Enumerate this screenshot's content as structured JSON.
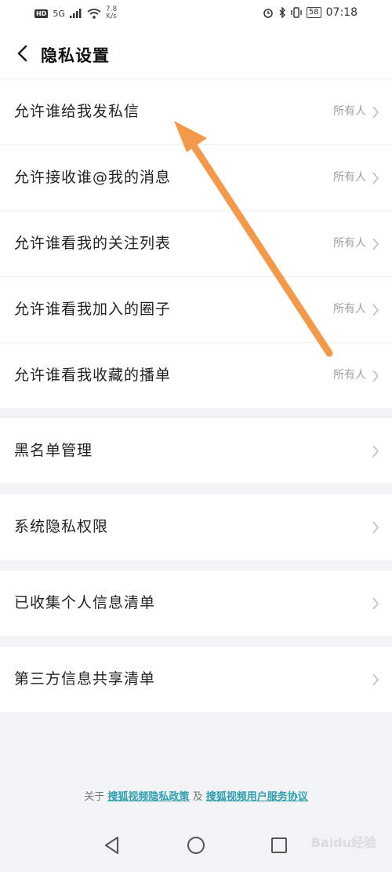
{
  "status_bar": {
    "hd": "HD",
    "signal": "5G",
    "net_speed_value": "7.8",
    "net_speed_unit": "K/s",
    "battery": "58",
    "time": "07:18"
  },
  "header": {
    "title": "隐私设置"
  },
  "privacy_rows": [
    {
      "label": "允许谁给我发私信",
      "value": "所有人"
    },
    {
      "label": "允许接收谁@我的消息",
      "value": "所有人"
    },
    {
      "label": "允许谁看我的关注列表",
      "value": "所有人"
    },
    {
      "label": "允许谁看我加入的圈子",
      "value": "所有人"
    },
    {
      "label": "允许谁看我收藏的播单",
      "value": "所有人"
    }
  ],
  "menu_rows": [
    {
      "label": "黑名单管理"
    },
    {
      "label": "系统隐私权限"
    },
    {
      "label": "已收集个人信息清单"
    },
    {
      "label": "第三方信息共享清单"
    }
  ],
  "footer": {
    "prefix": "关于",
    "privacy_policy_link": "搜狐视频隐私政策",
    "conjunction": "及",
    "user_agreement_link": "搜狐视频用户服务协议"
  },
  "watermark": "Baidu经验",
  "colors": {
    "accent_link": "#2e9fb0",
    "annotation_arrow": "#f29a4a",
    "background": "#f1f3f5"
  }
}
